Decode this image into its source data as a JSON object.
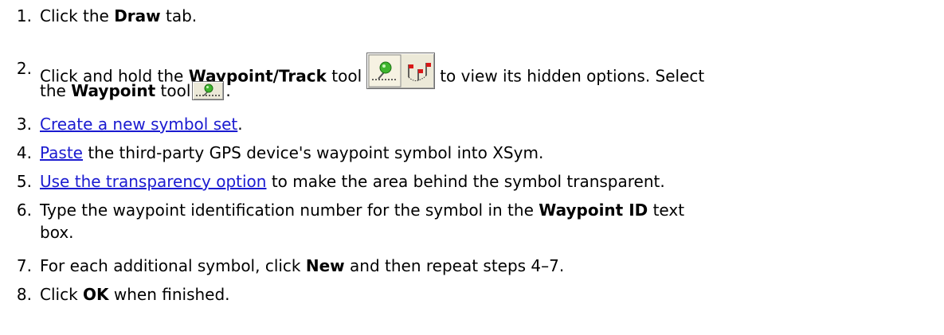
{
  "steps": [
    {
      "num": "1.",
      "parts": [
        "Click the ",
        "Draw",
        " tab."
      ]
    },
    {
      "num": "2.",
      "parts": [
        "Click and hold the ",
        "Waypoint/Track",
        " tool",
        "to view its hidden options. Select",
        "the ",
        "Waypoint",
        " tool",
        "."
      ]
    },
    {
      "num": "3.",
      "link": "Create a new symbol set",
      "after": "."
    },
    {
      "num": "4.",
      "link": "Paste",
      "after": " the third-party GPS device's waypoint symbol into XSym."
    },
    {
      "num": "5.",
      "link": "Use the transparency option",
      "after": " to make the area behind the symbol transparent."
    },
    {
      "num": "6.",
      "parts": [
        "Type the waypoint identification number for the symbol in the ",
        "Waypoint ID",
        " text",
        "box."
      ]
    },
    {
      "num": "7.",
      "parts": [
        "For each additional symbol, click ",
        "New",
        " and then repeat steps 4–7."
      ]
    },
    {
      "num": "8.",
      "parts": [
        "Click ",
        "OK",
        " when finished."
      ]
    }
  ],
  "icons": {
    "waypoint_track_tool": "waypoint-track-tool-icon",
    "waypoint_tool": "waypoint-tool-icon"
  },
  "colors": {
    "link": "#1a1ad0",
    "pin_green": "#3fb52e",
    "flag_red": "#d81818"
  }
}
